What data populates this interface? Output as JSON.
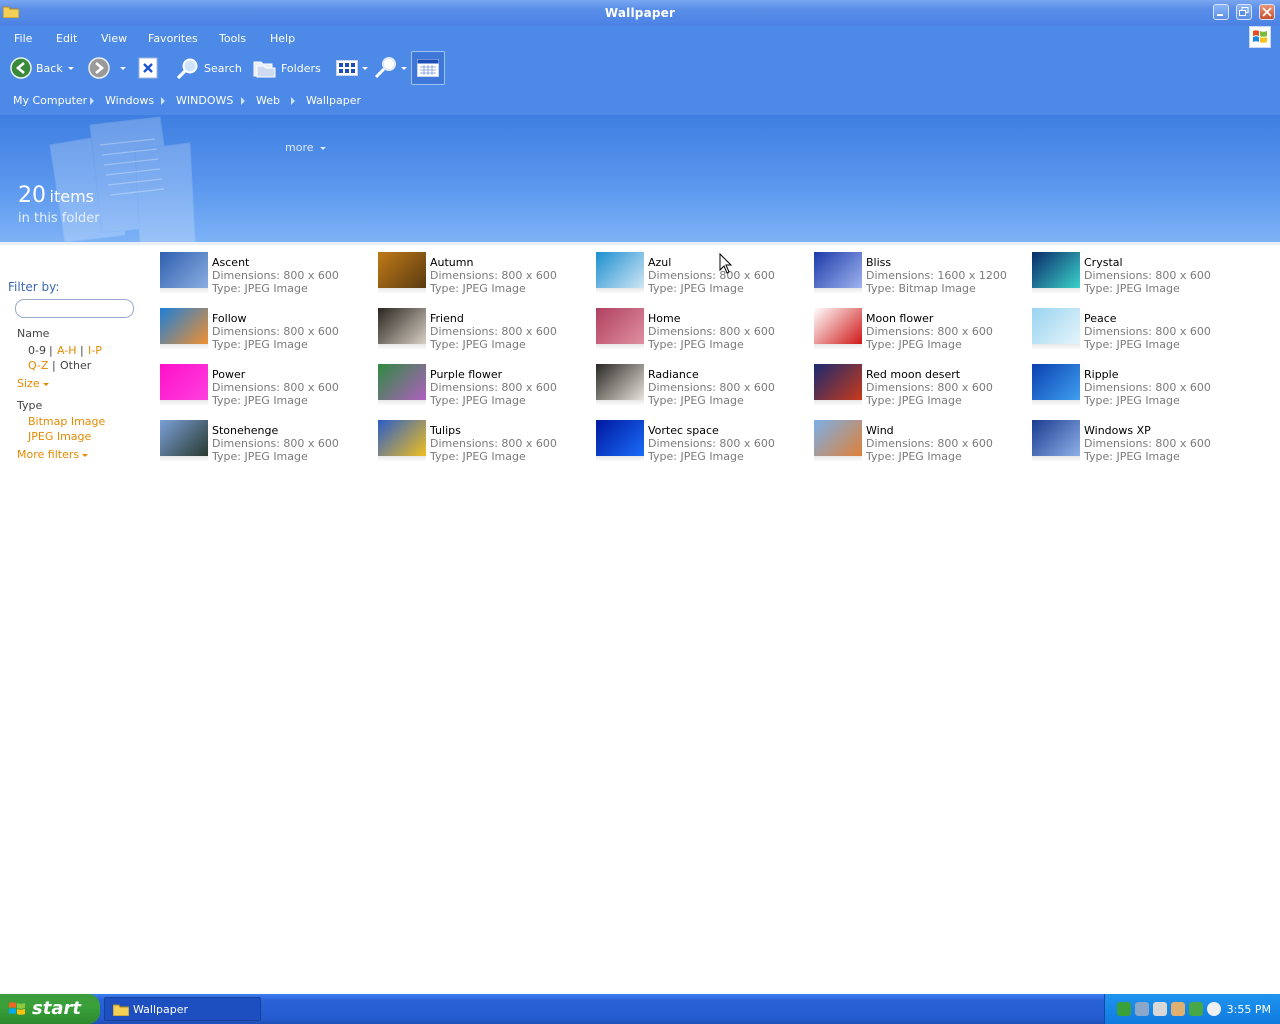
{
  "window": {
    "title": "Wallpaper"
  },
  "menu": [
    "File",
    "Edit",
    "View",
    "Favorites",
    "Tools",
    "Help"
  ],
  "toolbar": {
    "back_label": "Back",
    "search_label": "Search",
    "folders_label": "Folders"
  },
  "breadcrumb": [
    "My Computer",
    "Windows",
    "WINDOWS",
    "Web",
    "Wallpaper"
  ],
  "header": {
    "more_label": "more",
    "count": "20",
    "count_word": "items",
    "count_sub": "in this folder"
  },
  "filter": {
    "title": "Filter by:",
    "name_label": "Name",
    "name_links": [
      "0-9",
      "A-H",
      "I-P",
      "Q-Z",
      "Other"
    ],
    "size_label": "Size",
    "type_label": "Type",
    "type_links": [
      "Bitmap Image",
      "JPEG Image"
    ],
    "more_filters": "More filters"
  },
  "items": [
    {
      "name": "Ascent",
      "dims": "Dimensions: 800 x 600",
      "type": "Type: JPEG Image",
      "colors": [
        "#2f5fb0",
        "#8aaee0"
      ]
    },
    {
      "name": "Autumn",
      "dims": "Dimensions: 800 x 600",
      "type": "Type: JPEG Image",
      "colors": [
        "#c07a18",
        "#5a3a10"
      ]
    },
    {
      "name": "Azul",
      "dims": "Dimensions: 800 x 600",
      "type": "Type: JPEG Image",
      "colors": [
        "#1d8fd0",
        "#cfe6f5"
      ]
    },
    {
      "name": "Bliss",
      "dims": "Dimensions: 1600 x 1200",
      "type": "Type: Bitmap Image",
      "colors": [
        "#1d3aa8",
        "#9fb4f0"
      ]
    },
    {
      "name": "Crystal",
      "dims": "Dimensions: 800 x 600",
      "type": "Type: JPEG Image",
      "colors": [
        "#0a2a6a",
        "#3bd2c9"
      ]
    },
    {
      "name": "Follow",
      "dims": "Dimensions: 800 x 600",
      "type": "Type: JPEG Image",
      "colors": [
        "#1d7fd8",
        "#f09030"
      ]
    },
    {
      "name": "Friend",
      "dims": "Dimensions: 800 x 600",
      "type": "Type: JPEG Image",
      "colors": [
        "#2a2520",
        "#d8d0c4"
      ]
    },
    {
      "name": "Home",
      "dims": "Dimensions: 800 x 600",
      "type": "Type: JPEG Image",
      "colors": [
        "#b04060",
        "#e090a0"
      ]
    },
    {
      "name": "Moon flower",
      "dims": "Dimensions: 800 x 600",
      "type": "Type: JPEG Image",
      "colors": [
        "#ffffff",
        "#d01818"
      ]
    },
    {
      "name": "Peace",
      "dims": "Dimensions: 800 x 600",
      "type": "Type: JPEG Image",
      "colors": [
        "#9ad4f0",
        "#e4f4fb"
      ]
    },
    {
      "name": "Power",
      "dims": "Dimensions: 800 x 600",
      "type": "Type: JPEG Image",
      "colors": [
        "#ff10c8",
        "#ff40e0"
      ]
    },
    {
      "name": "Purple flower",
      "dims": "Dimensions: 800 x 600",
      "type": "Type: JPEG Image",
      "colors": [
        "#2f8a40",
        "#b060c0"
      ]
    },
    {
      "name": "Radiance",
      "dims": "Dimensions: 800 x 600",
      "type": "Type: JPEG Image",
      "colors": [
        "#2a2824",
        "#e8e4dc"
      ]
    },
    {
      "name": "Red moon desert",
      "dims": "Dimensions: 800 x 600",
      "type": "Type: JPEG Image",
      "colors": [
        "#1a2a70",
        "#c83a1a"
      ]
    },
    {
      "name": "Ripple",
      "dims": "Dimensions: 800 x 600",
      "type": "Type: JPEG Image",
      "colors": [
        "#0a40b0",
        "#40a0f0"
      ]
    },
    {
      "name": "Stonehenge",
      "dims": "Dimensions: 800 x 600",
      "type": "Type: JPEG Image",
      "colors": [
        "#7aa0d8",
        "#2a3a30"
      ]
    },
    {
      "name": "Tulips",
      "dims": "Dimensions: 800 x 600",
      "type": "Type: JPEG Image",
      "colors": [
        "#2a5cc8",
        "#f0c020"
      ]
    },
    {
      "name": "Vortec space",
      "dims": "Dimensions: 800 x 600",
      "type": "Type: JPEG Image",
      "colors": [
        "#0018a0",
        "#1a6cf8"
      ]
    },
    {
      "name": "Wind",
      "dims": "Dimensions: 800 x 600",
      "type": "Type: JPEG Image",
      "colors": [
        "#7ab0e8",
        "#e08038"
      ]
    },
    {
      "name": "Windows XP",
      "dims": "Dimensions: 800 x 600",
      "type": "Type: JPEG Image",
      "colors": [
        "#1a3c90",
        "#8fb0e8"
      ]
    }
  ],
  "taskbar": {
    "start_label": "start",
    "task_label": "Wallpaper",
    "clock": "3:55 PM"
  },
  "colors": {
    "chrome_blue": "#4d89e6",
    "link_orange": "#e58a00",
    "filter_title": "#3a69b0"
  }
}
